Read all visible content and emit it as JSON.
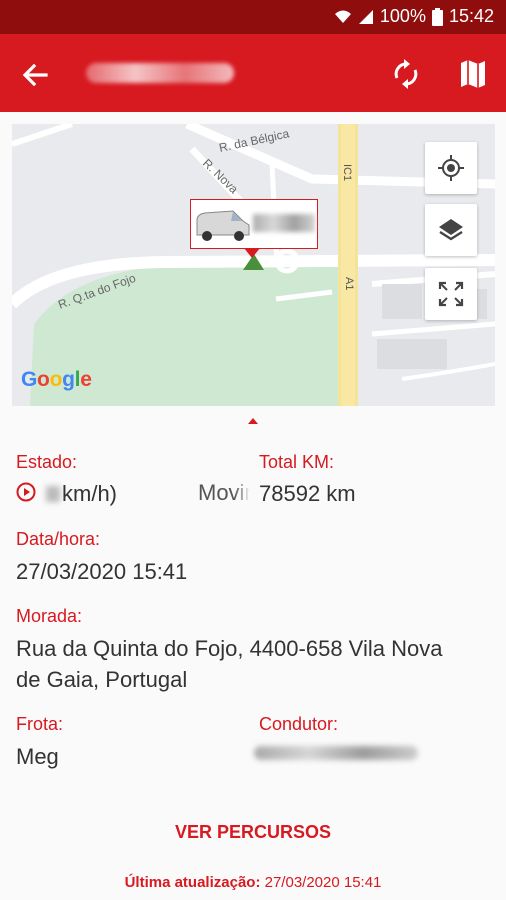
{
  "status_bar": {
    "battery": "100%",
    "time": "15:42"
  },
  "app_bar": {
    "title": ""
  },
  "map": {
    "streets": [
      "R. da Bélgica",
      "R. Nova",
      "R. Q.ta do Fojo",
      "IC1",
      "A1"
    ],
    "google_logo": "Google"
  },
  "details": {
    "estado_label": "Estado:",
    "speed_text": "km/h)",
    "movement_text": "Movimento",
    "total_km_label": "Total KM:",
    "total_km_value": "78592 km",
    "datetime_label": "Data/hora:",
    "datetime_value": "27/03/2020 15:41",
    "morada_label": "Morada:",
    "morada_line1": "Rua da Quinta do Fojo, 4400-658 Vila Nova",
    "morada_line2": "de Gaia, Portugal",
    "frota_label": "Frota:",
    "frota_value": "Meg",
    "condutor_label": "Condutor:"
  },
  "actions": {
    "ver_percursos": "VER PERCURSOS"
  },
  "footer": {
    "last_update_label": "Última atualização:",
    "last_update_value": "27/03/2020 15:41"
  },
  "colors": {
    "primary": "#d71920",
    "status_bar": "#8f0d0d",
    "text": "#333333"
  }
}
